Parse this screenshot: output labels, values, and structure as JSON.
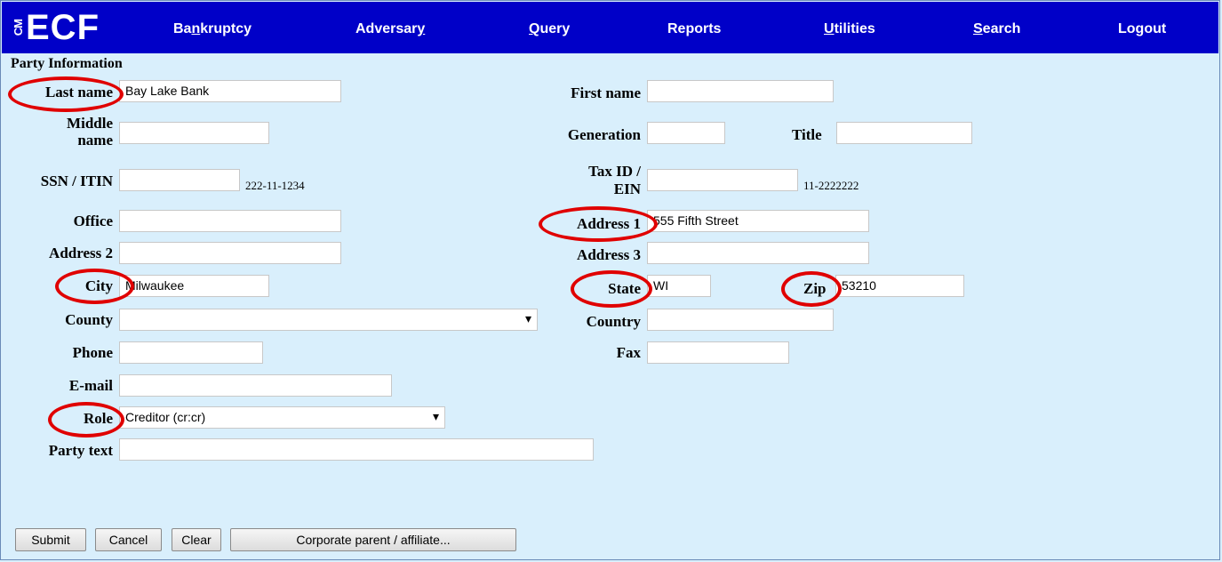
{
  "logo": {
    "small": "CM",
    "main": "ECF"
  },
  "nav": {
    "bankruptcy": {
      "pre": "Ba",
      "u": "n",
      "post": "kruptcy"
    },
    "adversary": {
      "pre": "Adversar",
      "u": "y",
      "post": ""
    },
    "query": {
      "pre": "",
      "u": "Q",
      "post": "uery"
    },
    "reports": "Reports",
    "utilities": {
      "pre": "",
      "u": "U",
      "post": "tilities"
    },
    "search": {
      "pre": "",
      "u": "S",
      "post": "earch"
    },
    "logout": "Logout"
  },
  "section_title": "Party Information",
  "fields": {
    "last_name": {
      "label": "Last name",
      "value": "Bay Lake Bank"
    },
    "first_name": {
      "label": "First name",
      "value": ""
    },
    "middle_name": {
      "label_1": "Middle",
      "label_2": "name",
      "value": ""
    },
    "generation": {
      "label": "Generation",
      "value": ""
    },
    "title": {
      "label": "Title",
      "value": ""
    },
    "ssn": {
      "label": "SSN / ITIN",
      "value": "",
      "hint": "222-11-1234"
    },
    "tax_id": {
      "label_1": "Tax ID /",
      "label_2": "EIN",
      "value": "",
      "hint": "11-2222222"
    },
    "office": {
      "label": "Office",
      "value": ""
    },
    "address1": {
      "label": "Address 1",
      "value": "555 Fifth Street"
    },
    "address2": {
      "label": "Address 2",
      "value": ""
    },
    "address3": {
      "label": "Address 3",
      "value": ""
    },
    "city": {
      "label": "City",
      "value": "Milwaukee"
    },
    "state": {
      "label": "State",
      "value": "WI"
    },
    "zip": {
      "label": "Zip",
      "value": "53210"
    },
    "county": {
      "label": "County",
      "value": ""
    },
    "country": {
      "label": "Country",
      "value": ""
    },
    "phone": {
      "label": "Phone",
      "value": ""
    },
    "fax": {
      "label": "Fax",
      "value": ""
    },
    "email": {
      "label": "E-mail",
      "value": ""
    },
    "role": {
      "label": "Role",
      "value": "Creditor (cr:cr)"
    },
    "party_text": {
      "label": "Party text",
      "value": ""
    }
  },
  "buttons": {
    "submit": "Submit",
    "cancel": "Cancel",
    "clear": "Clear",
    "corporate": "Corporate parent / affiliate..."
  },
  "colors": {
    "navbar": "#0000c8",
    "background": "#d9effc",
    "highlight_circle": "#e00000"
  }
}
